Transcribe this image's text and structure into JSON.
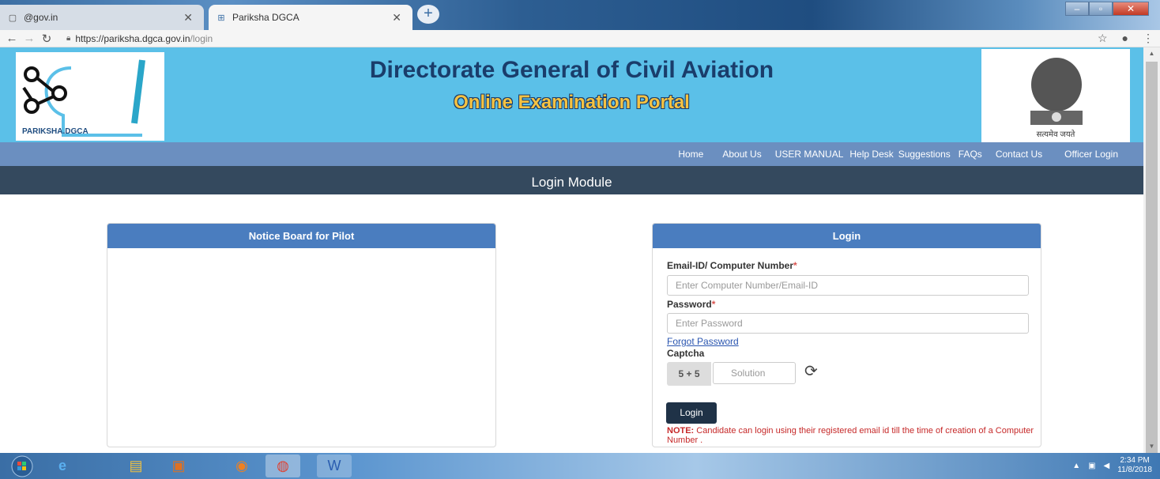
{
  "browser": {
    "tabs": [
      {
        "title": "@gov.in",
        "active": false
      },
      {
        "title": "Pariksha DGCA",
        "active": true
      }
    ],
    "new_tab": "+",
    "url_host": "https://pariksha.dgca.gov.in",
    "url_path": "/login"
  },
  "site": {
    "logo_text": "PARIKSHA.DGCA",
    "title": "Directorate General of Civil Aviation",
    "subtitle": "Online Examination Portal",
    "motto": "सत्यमेव जयते"
  },
  "nav": {
    "items": [
      "Home",
      "About Us",
      "USER MANUAL",
      "Help Desk",
      "Suggestions",
      "FAQs",
      "Contact Us",
      "Officer Login"
    ]
  },
  "module_title": "Login Module",
  "notice_board": {
    "title": "Notice Board for Pilot"
  },
  "login": {
    "title": "Login",
    "email_label": "Email-ID/ Computer Number",
    "email_placeholder": "Enter Computer Number/Email-ID",
    "password_label": "Password",
    "password_placeholder": "Enter Password",
    "required_mark": "*",
    "forgot_link": "Forgot Password",
    "captcha_label": "Captcha",
    "captcha_question": "5 + 5",
    "captcha_placeholder": "Solution",
    "button": "Login",
    "note_label": "NOTE:",
    "note_text": "Candidate can login using their registered email id till the time of creation of a Computer Number ."
  },
  "taskbar": {
    "time": "2:34 PM",
    "date": "11/8/2018"
  },
  "colors": {
    "header_bg": "#5bc0e8",
    "nav_bg": "#6b8fc0",
    "module_bar": "#34495e",
    "panel_head": "#4a7dbf",
    "login_button": "#1f3247",
    "note": "#c62828"
  }
}
